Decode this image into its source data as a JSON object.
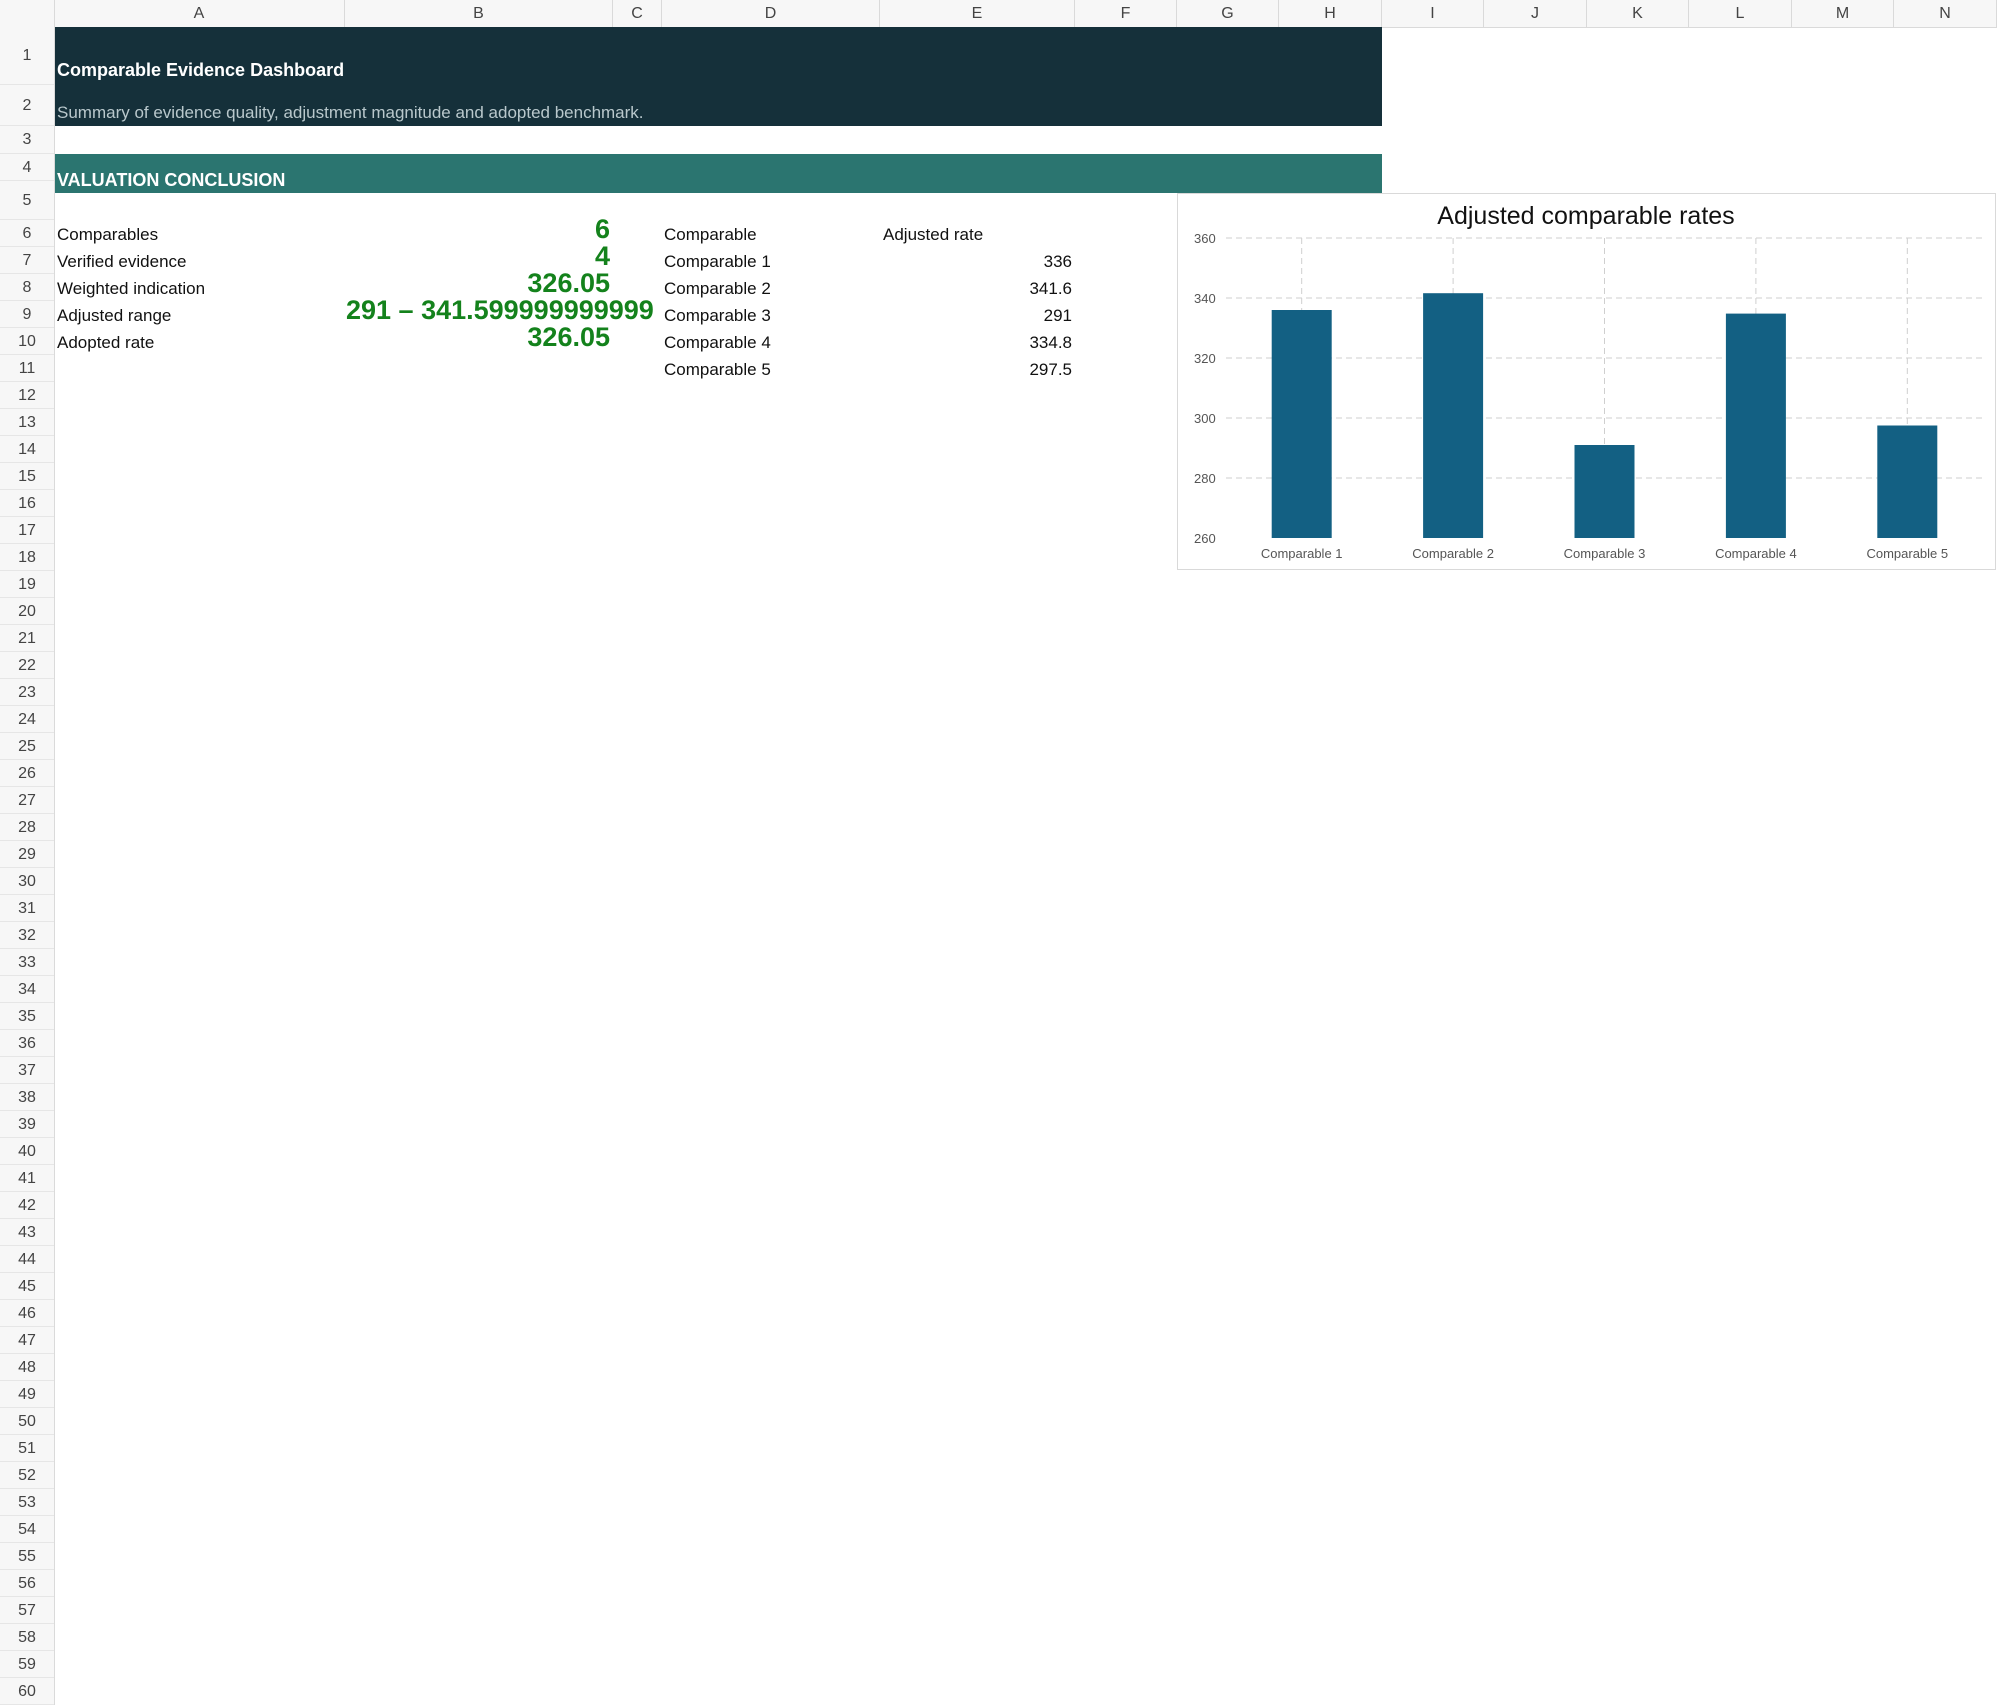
{
  "columns": [
    "A",
    "B",
    "C",
    "D",
    "E",
    "F",
    "G",
    "H",
    "I",
    "J",
    "K",
    "L",
    "M",
    "N"
  ],
  "rows": [
    1,
    2,
    3,
    4,
    5,
    6,
    7,
    8,
    9,
    10,
    11,
    12,
    13,
    14,
    15,
    16,
    17,
    18,
    19,
    20,
    21,
    22,
    23,
    24,
    25,
    26,
    27,
    28,
    29,
    30,
    31,
    32,
    33,
    34,
    35,
    36,
    37,
    38,
    39,
    40,
    41,
    42,
    43,
    44,
    45,
    46,
    47,
    48,
    49,
    50,
    51,
    52,
    53,
    54,
    55,
    56,
    57,
    58,
    59,
    60
  ],
  "dashboard": {
    "title": "Comparable Evidence Dashboard",
    "subtitle": "Summary of evidence quality, adjustment magnitude and adopted benchmark.",
    "section": "VALUATION CONCLUSION"
  },
  "kpis": [
    {
      "label": "Comparables",
      "value": "6"
    },
    {
      "label": "Verified evidence",
      "value": "4"
    },
    {
      "label": "Weighted indication",
      "value": "326.05"
    },
    {
      "label": "Adjusted range",
      "value": "291 – 341.599999999999"
    },
    {
      "label": "Adopted rate",
      "value": "326.05"
    }
  ],
  "table": {
    "headers": [
      "Comparable",
      "Adjusted rate"
    ],
    "rows": [
      {
        "name": "Comparable 1",
        "rate": "336"
      },
      {
        "name": "Comparable 2",
        "rate": "341.6"
      },
      {
        "name": "Comparable 3",
        "rate": "291"
      },
      {
        "name": "Comparable 4",
        "rate": "334.8"
      },
      {
        "name": "Comparable 5",
        "rate": "297.5"
      }
    ]
  },
  "colors": {
    "bar": "#136083",
    "kpi": "#14821c",
    "title_band": "#15303a",
    "section_band": "#2b7570"
  },
  "chart_data": {
    "type": "bar",
    "title": "Adjusted comparable rates",
    "categories": [
      "Comparable 1",
      "Comparable 2",
      "Comparable 3",
      "Comparable 4",
      "Comparable 5"
    ],
    "values": [
      336,
      341.6,
      291,
      334.8,
      297.5
    ],
    "ylim": [
      260,
      360
    ],
    "yticks": [
      360,
      340,
      320,
      300,
      280,
      260
    ],
    "xlabel": "",
    "ylabel": "",
    "grid": true,
    "legend": "none"
  }
}
